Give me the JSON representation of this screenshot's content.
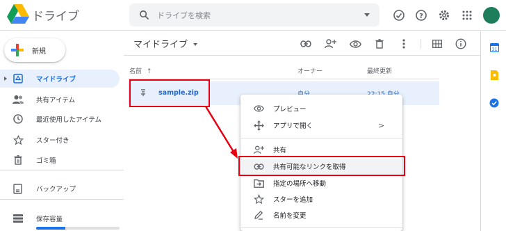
{
  "app": {
    "title": "ドライブ"
  },
  "search": {
    "placeholder": "ドライブを検索"
  },
  "top_icons": [
    "offline-check-icon",
    "help-icon",
    "settings-icon",
    "apps-grid-icon",
    "avatar"
  ],
  "sidebar": {
    "new_label": "新規",
    "items": [
      {
        "label": "マイドライブ",
        "icon": "drive-icon",
        "active": true
      },
      {
        "label": "共有アイテム",
        "icon": "people-icon"
      },
      {
        "label": "最近使用したアイテム",
        "icon": "clock-icon"
      },
      {
        "label": "スター付き",
        "icon": "star-icon"
      },
      {
        "label": "ゴミ箱",
        "icon": "trash-icon"
      },
      {
        "label": "バックアップ",
        "icon": "backup-icon"
      },
      {
        "label": "保存容量",
        "icon": "storage-icon"
      }
    ],
    "storage_used_fraction": 0.35
  },
  "main": {
    "title": "マイドライブ",
    "columns": {
      "name": "名前",
      "sort_arrow": "↑",
      "owner": "オーナー",
      "modified": "最終更新"
    },
    "files": [
      {
        "name": "sample.zip",
        "owner": "自分",
        "modified": "22:15 自分"
      }
    ]
  },
  "context_menu": {
    "items": [
      {
        "label": "プレビュー",
        "icon": "eye-icon"
      },
      {
        "label": "アプリで開く",
        "icon": "open-with-icon",
        "submenu_arrow": ">"
      },
      {
        "label": "共有",
        "icon": "add-person-icon"
      },
      {
        "label": "共有可能なリンクを取得",
        "icon": "link-icon",
        "highlighted": true
      },
      {
        "label": "指定の場所へ移動",
        "icon": "move-icon"
      },
      {
        "label": "スターを追加",
        "icon": "star-icon"
      },
      {
        "label": "名前を変更",
        "icon": "rename-icon"
      }
    ]
  },
  "colors": {
    "accent": "#1a73e8",
    "annotation": "#e60012",
    "selected_row": "#e8f0fe"
  }
}
